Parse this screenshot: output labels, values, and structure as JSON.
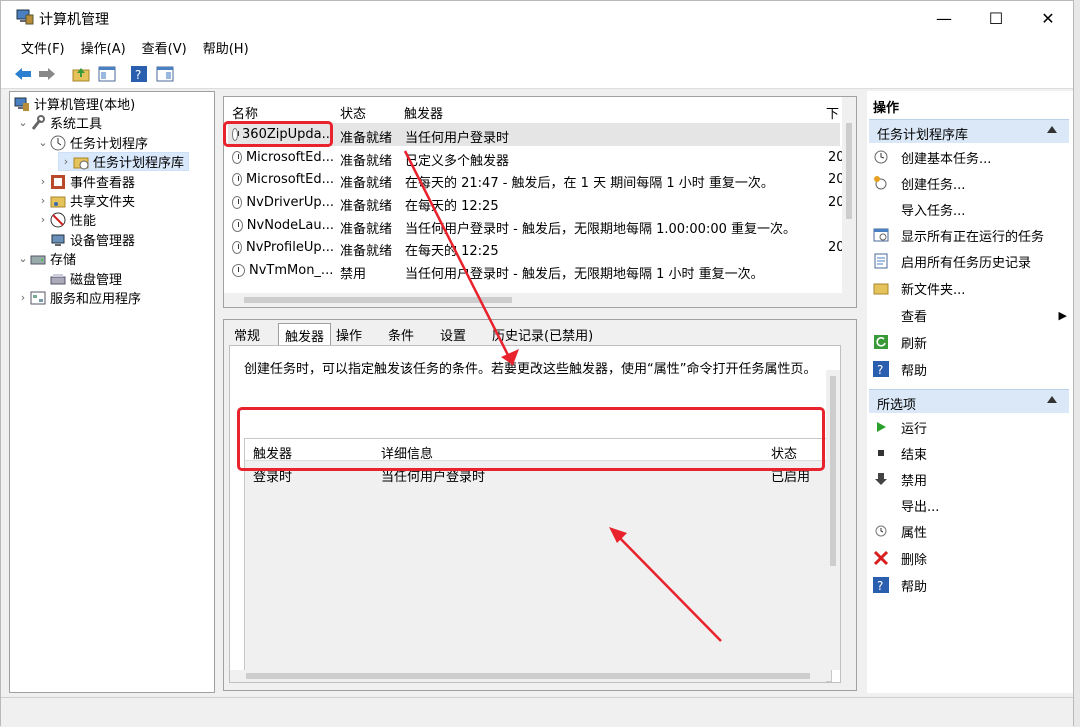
{
  "window": {
    "title": "计算机管理",
    "minimize": "—",
    "maximize": "☐",
    "close": "✕"
  },
  "menu": [
    "文件(F)",
    "操作(A)",
    "查看(V)",
    "帮助(H)"
  ],
  "tree": [
    {
      "label": "计算机管理(本地)",
      "icon": "computer-icon"
    },
    {
      "label": "系统工具",
      "icon": "tools-icon"
    },
    {
      "label": "任务计划程序",
      "icon": "clock-icon"
    },
    {
      "label": "任务计划程序库",
      "icon": "folder-icon"
    },
    {
      "label": "事件查看器",
      "icon": "event-icon"
    },
    {
      "label": "共享文件夹",
      "icon": "share-icon"
    },
    {
      "label": "性能",
      "icon": "performance-icon"
    },
    {
      "label": "设备管理器",
      "icon": "device-icon"
    },
    {
      "label": "存储",
      "icon": "storage-icon"
    },
    {
      "label": "磁盘管理",
      "icon": "disk-icon"
    },
    {
      "label": "服务和应用程序",
      "icon": "services-icon"
    }
  ],
  "tasklist": {
    "headers": [
      "名称",
      "状态",
      "触发器",
      "下"
    ],
    "rows": [
      {
        "name": "360ZipUpda...",
        "status": "准备就绪",
        "trigger": "当任何用户登录时",
        "next": ""
      },
      {
        "name": "MicrosoftEd...",
        "status": "准备就绪",
        "trigger": "已定义多个触发器",
        "next": "20"
      },
      {
        "name": "MicrosoftEd...",
        "status": "准备就绪",
        "trigger": "在每天的 21:47 - 触发后，在 1 天 期间每隔 1 小时 重复一次。",
        "next": "20"
      },
      {
        "name": "NvDriverUp...",
        "status": "准备就绪",
        "trigger": "在每天的 12:25",
        "next": "20"
      },
      {
        "name": "NvNodeLau...",
        "status": "准备就绪",
        "trigger": "当任何用户登录时 - 触发后，无限期地每隔 1.00:00:00 重复一次。",
        "next": ""
      },
      {
        "name": "NvProfileUp...",
        "status": "准备就绪",
        "trigger": "在每天的 12:25",
        "next": "20"
      },
      {
        "name": "NvTmMon_...",
        "status": "禁用",
        "trigger": "当任何用户登录时 - 触发后，无限期地每隔 1 小时 重复一次。",
        "next": ""
      }
    ]
  },
  "detail": {
    "tabs": [
      "常规",
      "触发器",
      "操作",
      "条件",
      "设置",
      "历史记录(已禁用)"
    ],
    "description": "创建任务时，可以指定触发该任务的条件。若要更改这些触发器，使用“属性”命令打开任务属性页。",
    "grid_headers": [
      "触发器",
      "详细信息",
      "状态"
    ],
    "grid_row": [
      "登录时",
      "当任何用户登录时",
      "已启用"
    ]
  },
  "actions": {
    "title": "操作",
    "section1": "任务计划程序库",
    "items1": [
      {
        "label": "创建基本任务...",
        "icon": "basic-task-icon"
      },
      {
        "label": "创建任务...",
        "icon": "create-task-icon"
      },
      {
        "label": "导入任务...",
        "icon": ""
      },
      {
        "label": "显示所有正在运行的任务",
        "icon": "running-tasks-icon"
      },
      {
        "label": "启用所有任务历史记录",
        "icon": "history-icon"
      },
      {
        "label": "新文件夹...",
        "icon": "new-folder-icon"
      },
      {
        "label": "查看",
        "icon": ""
      },
      {
        "label": "刷新",
        "icon": "refresh-icon"
      },
      {
        "label": "帮助",
        "icon": "help-icon"
      }
    ],
    "section2": "所选项",
    "items2": [
      {
        "label": "运行",
        "icon": "run-icon"
      },
      {
        "label": "结束",
        "icon": "stop-icon"
      },
      {
        "label": "禁用",
        "icon": "disable-icon"
      },
      {
        "label": "导出...",
        "icon": ""
      },
      {
        "label": "属性",
        "icon": "properties-icon"
      },
      {
        "label": "删除",
        "icon": "delete-icon"
      },
      {
        "label": "帮助",
        "icon": "help-icon"
      }
    ]
  },
  "colors": {
    "highlight": "#e8232d",
    "selection": "#d9e8fb",
    "section": "#dbe8f8"
  }
}
